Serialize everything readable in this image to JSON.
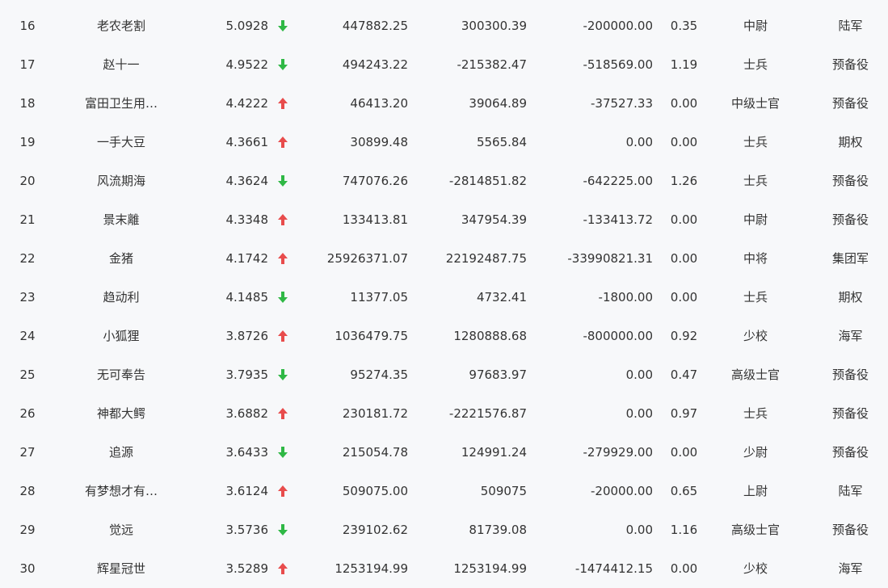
{
  "colors": {
    "up": "#e84c4c",
    "down": "#2fb845",
    "text": "#333333",
    "background": "#f7f8fa"
  },
  "rows": [
    {
      "rank": "16",
      "name": "老农老割",
      "score": "5.0928",
      "trend": "down",
      "a": "447882.25",
      "b": "300300.39",
      "c": "-200000.00",
      "d": "0.35",
      "level": "中尉",
      "type": "陆军"
    },
    {
      "rank": "17",
      "name": "赵十一",
      "score": "4.9522",
      "trend": "down",
      "a": "494243.22",
      "b": "-215382.47",
      "c": "-518569.00",
      "d": "1.19",
      "level": "士兵",
      "type": "预备役"
    },
    {
      "rank": "18",
      "name": "富田卫生用…",
      "score": "4.4222",
      "trend": "up",
      "a": "46413.20",
      "b": "39064.89",
      "c": "-37527.33",
      "d": "0.00",
      "level": "中级士官",
      "type": "预备役"
    },
    {
      "rank": "19",
      "name": "一手大豆",
      "score": "4.3661",
      "trend": "up",
      "a": "30899.48",
      "b": "5565.84",
      "c": "0.00",
      "d": "0.00",
      "level": "士兵",
      "type": "期权"
    },
    {
      "rank": "20",
      "name": "风流期海",
      "score": "4.3624",
      "trend": "down",
      "a": "747076.26",
      "b": "-2814851.82",
      "c": "-642225.00",
      "d": "1.26",
      "level": "士兵",
      "type": "预备役"
    },
    {
      "rank": "21",
      "name": "景末離",
      "score": "4.3348",
      "trend": "up",
      "a": "133413.81",
      "b": "347954.39",
      "c": "-133413.72",
      "d": "0.00",
      "level": "中尉",
      "type": "预备役"
    },
    {
      "rank": "22",
      "name": "金猪",
      "score": "4.1742",
      "trend": "up",
      "a": "25926371.07",
      "b": "22192487.75",
      "c": "-33990821.31",
      "d": "0.00",
      "level": "中将",
      "type": "集团军"
    },
    {
      "rank": "23",
      "name": "趋动利",
      "score": "4.1485",
      "trend": "down",
      "a": "11377.05",
      "b": "4732.41",
      "c": "-1800.00",
      "d": "0.00",
      "level": "士兵",
      "type": "期权"
    },
    {
      "rank": "24",
      "name": "小狐狸",
      "score": "3.8726",
      "trend": "up",
      "a": "1036479.75",
      "b": "1280888.68",
      "c": "-800000.00",
      "d": "0.92",
      "level": "少校",
      "type": "海军"
    },
    {
      "rank": "25",
      "name": "无可奉告",
      "score": "3.7935",
      "trend": "down",
      "a": "95274.35",
      "b": "97683.97",
      "c": "0.00",
      "d": "0.47",
      "level": "高级士官",
      "type": "预备役"
    },
    {
      "rank": "26",
      "name": "神都大鳄",
      "score": "3.6882",
      "trend": "up",
      "a": "230181.72",
      "b": "-2221576.87",
      "c": "0.00",
      "d": "0.97",
      "level": "士兵",
      "type": "预备役"
    },
    {
      "rank": "27",
      "name": "追源",
      "score": "3.6433",
      "trend": "down",
      "a": "215054.78",
      "b": "124991.24",
      "c": "-279929.00",
      "d": "0.00",
      "level": "少尉",
      "type": "预备役"
    },
    {
      "rank": "28",
      "name": "有梦想才有…",
      "score": "3.6124",
      "trend": "up",
      "a": "509075.00",
      "b": "509075",
      "c": "-20000.00",
      "d": "0.65",
      "level": "上尉",
      "type": "陆军"
    },
    {
      "rank": "29",
      "name": "觉远",
      "score": "3.5736",
      "trend": "down",
      "a": "239102.62",
      "b": "81739.08",
      "c": "0.00",
      "d": "1.16",
      "level": "高级士官",
      "type": "预备役"
    },
    {
      "rank": "30",
      "name": "辉星冠世",
      "score": "3.5289",
      "trend": "up",
      "a": "1253194.99",
      "b": "1253194.99",
      "c": "-1474412.15",
      "d": "0.00",
      "level": "少校",
      "type": "海军"
    }
  ]
}
